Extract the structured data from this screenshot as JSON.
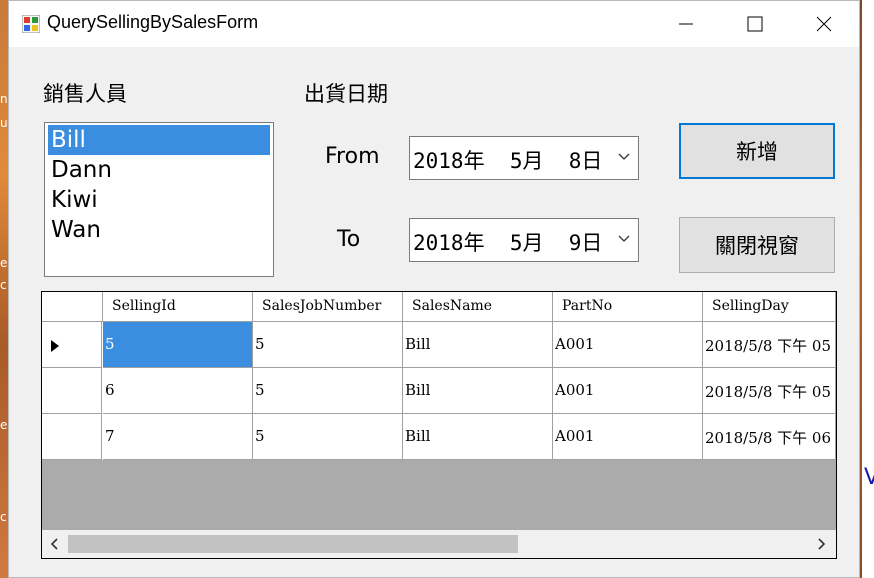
{
  "window": {
    "title": "QuerySellingBySalesForm"
  },
  "background": {
    "fragments": [
      "n",
      "u",
      "e",
      "c",
      "e",
      "c"
    ],
    "right_glyph": "V"
  },
  "labels": {
    "salesperson": "銷售人員",
    "ship_date": "出貨日期",
    "from": "From",
    "to": "To"
  },
  "sales_list": {
    "items": [
      "Bill",
      "Dann",
      "Kiwi",
      "Wan"
    ],
    "selected": "Bill"
  },
  "dates": {
    "from": "2018年  5月  8日",
    "to": "2018年  5月  9日"
  },
  "buttons": {
    "add": "新增",
    "close": "關閉視窗"
  },
  "grid": {
    "columns": [
      "SellingId",
      "SalesJobNumber",
      "SalesName",
      "PartNo",
      "SellingDay"
    ],
    "rows": [
      [
        "5",
        "5",
        "Bill",
        "A001",
        "2018/5/8 下午 05"
      ],
      [
        "6",
        "5",
        "Bill",
        "A001",
        "2018/5/8 下午 05"
      ],
      [
        "7",
        "5",
        "Bill",
        "A001",
        "2018/5/8 下午 06"
      ]
    ],
    "current_row": 0
  },
  "colors": {
    "selection": "#3b8de0",
    "default_button_border": "#0078d7",
    "grid_empty_area": "#ababab"
  }
}
